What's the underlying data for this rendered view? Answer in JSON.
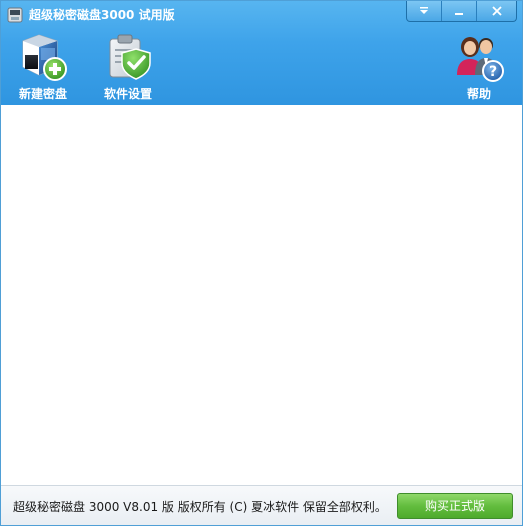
{
  "window": {
    "title": "超级秘密磁盘3000 试用版"
  },
  "toolbar": {
    "new_disk_label": "新建密盘",
    "settings_label": "软件设置",
    "help_label": "帮助"
  },
  "statusbar": {
    "copyright": "超级秘密磁盘  3000 V8.01 版  版权所有 (C)  夏冰软件 保留全部权利。",
    "buy_label": "购买正式版"
  },
  "icons": {
    "app": "disk-app-icon",
    "new_disk": "new-disk-icon",
    "settings": "clipboard-check-icon",
    "help": "help-people-icon",
    "menu": "chevron-down-icon",
    "minimize": "minimize-icon",
    "close": "close-icon"
  },
  "colors": {
    "header_blue": "#3ea3ea",
    "buy_green": "#63bd3e"
  }
}
